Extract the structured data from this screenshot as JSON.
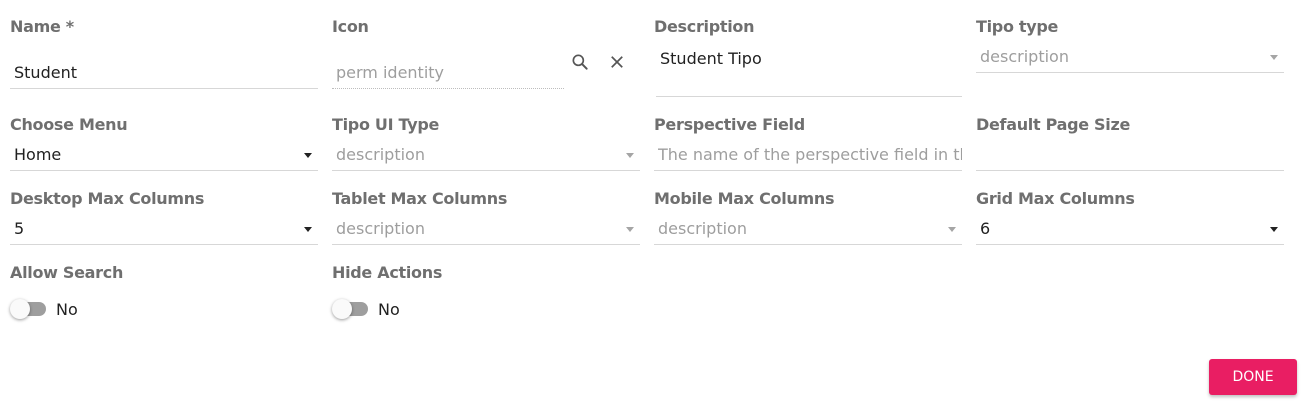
{
  "form": {
    "name": {
      "label": "Name *",
      "value": "Student"
    },
    "icon": {
      "label": "Icon",
      "placeholder": "perm identity",
      "search_icon": "search-icon",
      "clear_icon": "close-icon"
    },
    "description": {
      "label": "Description",
      "value": "Student Tipo"
    },
    "tipo_type": {
      "label": "Tipo type",
      "placeholder": "description"
    },
    "choose_menu": {
      "label": "Choose Menu",
      "value": "Home"
    },
    "tipo_ui_type": {
      "label": "Tipo UI Type",
      "placeholder": "description"
    },
    "perspective_field": {
      "label": "Perspective Field",
      "placeholder": "The name of the perspective field in the cl"
    },
    "default_page_size": {
      "label": "Default Page Size",
      "value": ""
    },
    "desktop_max_columns": {
      "label": "Desktop Max Columns",
      "value": "5"
    },
    "tablet_max_columns": {
      "label": "Tablet Max Columns",
      "placeholder": "description"
    },
    "mobile_max_columns": {
      "label": "Mobile Max Columns",
      "placeholder": "description"
    },
    "grid_max_columns": {
      "label": "Grid Max Columns",
      "value": "6"
    },
    "allow_search": {
      "label": "Allow Search",
      "state": "No"
    },
    "hide_actions": {
      "label": "Hide Actions",
      "state": "No"
    }
  },
  "actions": {
    "done_label": "DONE"
  },
  "colors": {
    "accent": "#e91e63",
    "label": "#6f6f6f",
    "placeholder": "#9e9e9e"
  }
}
